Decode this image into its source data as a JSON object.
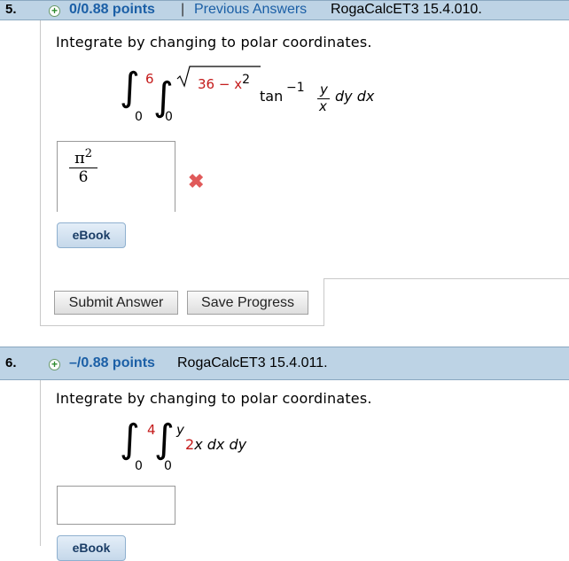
{
  "q5": {
    "number": "5.",
    "plus_icon": "+",
    "points": "0/0.88 points",
    "separator": "|",
    "previous_answers": "Previous Answers",
    "code": "RogaCalcET3 15.4.010.",
    "prompt": "Integrate by changing to polar coordinates.",
    "integral": {
      "outer_upper": "6",
      "outer_lower": "0",
      "inner_upper_radicand": "36 − x",
      "inner_upper_exp": "2",
      "inner_lower": "0",
      "func": "tan",
      "func_exp": "−1",
      "frac_num": "y",
      "frac_den": "x",
      "differentials": "dy dx"
    },
    "answer": {
      "numerator": "π",
      "exponent": "2",
      "denominator": "6"
    },
    "status_icon": "✖",
    "ebook_label": "eBook",
    "submit_label": "Submit Answer",
    "save_label": "Save Progress"
  },
  "q6": {
    "number": "6.",
    "plus_icon": "+",
    "points": "–/0.88 points",
    "code": "RogaCalcET3 15.4.011.",
    "prompt": "Integrate by changing to polar coordinates.",
    "integral": {
      "outer_upper": "4",
      "outer_lower": "0",
      "inner_upper": "y",
      "inner_lower": "0",
      "coef": "2",
      "rest": "x dx dy"
    },
    "answer_value": "",
    "ebook_label": "eBook"
  }
}
